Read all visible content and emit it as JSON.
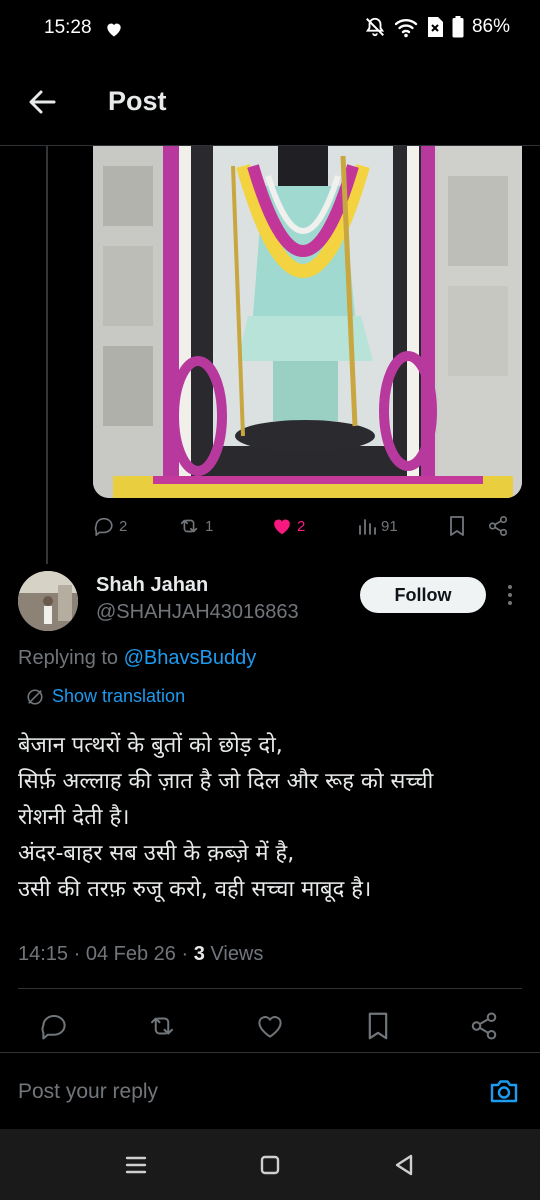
{
  "status_bar": {
    "time": "15:28",
    "battery": "86%"
  },
  "header": {
    "title": "Post"
  },
  "parent_post": {
    "image_alt": "Idol adorned with flower garlands inside a carved stone temple",
    "stats": {
      "replies": "2",
      "reposts": "1",
      "likes": "2",
      "views": "91"
    }
  },
  "reply_post": {
    "author_name": "Shah Jahan",
    "author_handle": "@SHAHJAH43016863",
    "follow_label": "Follow",
    "replying_prefix": "Replying to ",
    "replying_to": "@BhavsBuddy",
    "translate_label": "Show translation",
    "text_lines": [
      "बेजान पत्थरों के बुतों को छोड़ दो,",
      "सिर्फ़ अल्लाह की ज़ात है जो दिल और रूह को सच्ची",
      "रोशनी देती है।",
      "अंदर-बाहर सब उसी के क़ब्ज़े में है,",
      "उसी की तरफ़ रुजू करो, वही सच्चा माबूद है।"
    ],
    "time": "14:15",
    "date": "04 Feb 26",
    "views_count": "3",
    "views_label": "Views"
  },
  "reply_bar": {
    "placeholder": "Post your reply"
  },
  "colors": {
    "accent": "#1d9bf0",
    "like": "#f91880",
    "muted": "#71767b",
    "text": "#e7e9ea",
    "background": "#000000"
  }
}
